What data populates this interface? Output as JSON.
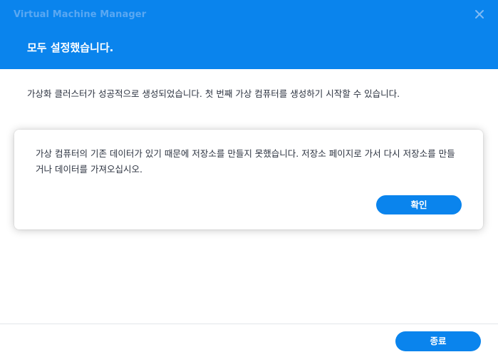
{
  "window": {
    "app_title": "Virtual Machine Manager",
    "close_icon": "close-icon"
  },
  "header": {
    "title": "모두 설정했습니다."
  },
  "main": {
    "message": "가상화 클러스터가 성공적으로 생성되었습니다. 첫 번째 가상 컴퓨터를 생성하기 시작할 수 있습니다."
  },
  "dialog": {
    "text": "가상 컴퓨터의 기존 데이터가 있기 때문에 저장소를 만들지 못했습니다. 저장소 페이지로 가서 다시 저장소를 만들거나 데이터를 가져오십시오.",
    "ok_label": "확인"
  },
  "footer": {
    "finish_label": "종료"
  },
  "colors": {
    "accent": "#0a84ed",
    "text": "#2c3340"
  }
}
